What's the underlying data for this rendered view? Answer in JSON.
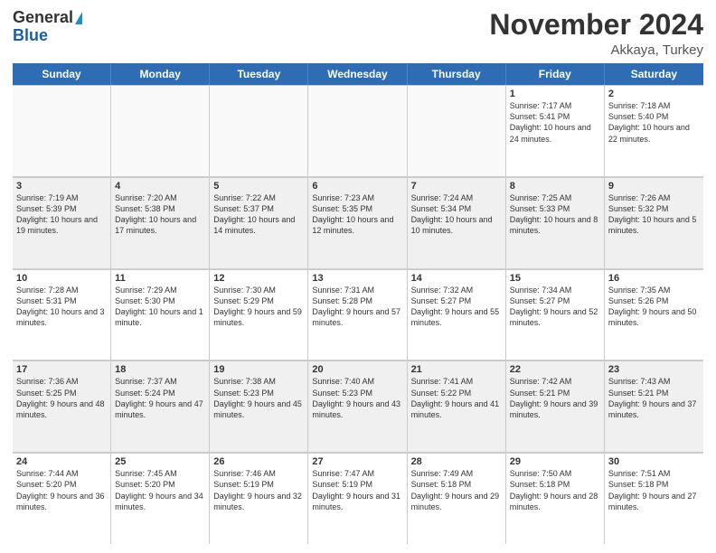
{
  "header": {
    "logo_general": "General",
    "logo_blue": "Blue",
    "month_title": "November 2024",
    "location": "Akkaya, Turkey"
  },
  "days_of_week": [
    "Sunday",
    "Monday",
    "Tuesday",
    "Wednesday",
    "Thursday",
    "Friday",
    "Saturday"
  ],
  "weeks": [
    [
      {
        "day": "",
        "info": ""
      },
      {
        "day": "",
        "info": ""
      },
      {
        "day": "",
        "info": ""
      },
      {
        "day": "",
        "info": ""
      },
      {
        "day": "",
        "info": ""
      },
      {
        "day": "1",
        "info": "Sunrise: 7:17 AM\nSunset: 5:41 PM\nDaylight: 10 hours and 24 minutes."
      },
      {
        "day": "2",
        "info": "Sunrise: 7:18 AM\nSunset: 5:40 PM\nDaylight: 10 hours and 22 minutes."
      }
    ],
    [
      {
        "day": "3",
        "info": "Sunrise: 7:19 AM\nSunset: 5:39 PM\nDaylight: 10 hours and 19 minutes."
      },
      {
        "day": "4",
        "info": "Sunrise: 7:20 AM\nSunset: 5:38 PM\nDaylight: 10 hours and 17 minutes."
      },
      {
        "day": "5",
        "info": "Sunrise: 7:22 AM\nSunset: 5:37 PM\nDaylight: 10 hours and 14 minutes."
      },
      {
        "day": "6",
        "info": "Sunrise: 7:23 AM\nSunset: 5:35 PM\nDaylight: 10 hours and 12 minutes."
      },
      {
        "day": "7",
        "info": "Sunrise: 7:24 AM\nSunset: 5:34 PM\nDaylight: 10 hours and 10 minutes."
      },
      {
        "day": "8",
        "info": "Sunrise: 7:25 AM\nSunset: 5:33 PM\nDaylight: 10 hours and 8 minutes."
      },
      {
        "day": "9",
        "info": "Sunrise: 7:26 AM\nSunset: 5:32 PM\nDaylight: 10 hours and 5 minutes."
      }
    ],
    [
      {
        "day": "10",
        "info": "Sunrise: 7:28 AM\nSunset: 5:31 PM\nDaylight: 10 hours and 3 minutes."
      },
      {
        "day": "11",
        "info": "Sunrise: 7:29 AM\nSunset: 5:30 PM\nDaylight: 10 hours and 1 minute."
      },
      {
        "day": "12",
        "info": "Sunrise: 7:30 AM\nSunset: 5:29 PM\nDaylight: 9 hours and 59 minutes."
      },
      {
        "day": "13",
        "info": "Sunrise: 7:31 AM\nSunset: 5:28 PM\nDaylight: 9 hours and 57 minutes."
      },
      {
        "day": "14",
        "info": "Sunrise: 7:32 AM\nSunset: 5:27 PM\nDaylight: 9 hours and 55 minutes."
      },
      {
        "day": "15",
        "info": "Sunrise: 7:34 AM\nSunset: 5:27 PM\nDaylight: 9 hours and 52 minutes."
      },
      {
        "day": "16",
        "info": "Sunrise: 7:35 AM\nSunset: 5:26 PM\nDaylight: 9 hours and 50 minutes."
      }
    ],
    [
      {
        "day": "17",
        "info": "Sunrise: 7:36 AM\nSunset: 5:25 PM\nDaylight: 9 hours and 48 minutes."
      },
      {
        "day": "18",
        "info": "Sunrise: 7:37 AM\nSunset: 5:24 PM\nDaylight: 9 hours and 47 minutes."
      },
      {
        "day": "19",
        "info": "Sunrise: 7:38 AM\nSunset: 5:23 PM\nDaylight: 9 hours and 45 minutes."
      },
      {
        "day": "20",
        "info": "Sunrise: 7:40 AM\nSunset: 5:23 PM\nDaylight: 9 hours and 43 minutes."
      },
      {
        "day": "21",
        "info": "Sunrise: 7:41 AM\nSunset: 5:22 PM\nDaylight: 9 hours and 41 minutes."
      },
      {
        "day": "22",
        "info": "Sunrise: 7:42 AM\nSunset: 5:21 PM\nDaylight: 9 hours and 39 minutes."
      },
      {
        "day": "23",
        "info": "Sunrise: 7:43 AM\nSunset: 5:21 PM\nDaylight: 9 hours and 37 minutes."
      }
    ],
    [
      {
        "day": "24",
        "info": "Sunrise: 7:44 AM\nSunset: 5:20 PM\nDaylight: 9 hours and 36 minutes."
      },
      {
        "day": "25",
        "info": "Sunrise: 7:45 AM\nSunset: 5:20 PM\nDaylight: 9 hours and 34 minutes."
      },
      {
        "day": "26",
        "info": "Sunrise: 7:46 AM\nSunset: 5:19 PM\nDaylight: 9 hours and 32 minutes."
      },
      {
        "day": "27",
        "info": "Sunrise: 7:47 AM\nSunset: 5:19 PM\nDaylight: 9 hours and 31 minutes."
      },
      {
        "day": "28",
        "info": "Sunrise: 7:49 AM\nSunset: 5:18 PM\nDaylight: 9 hours and 29 minutes."
      },
      {
        "day": "29",
        "info": "Sunrise: 7:50 AM\nSunset: 5:18 PM\nDaylight: 9 hours and 28 minutes."
      },
      {
        "day": "30",
        "info": "Sunrise: 7:51 AM\nSunset: 5:18 PM\nDaylight: 9 hours and 27 minutes."
      }
    ]
  ]
}
